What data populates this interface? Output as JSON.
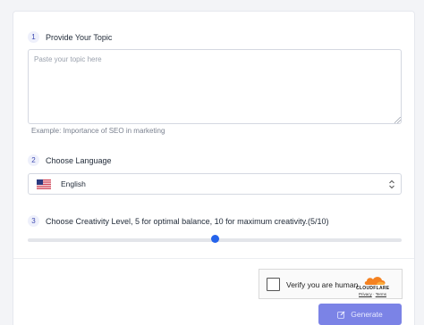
{
  "form": {
    "step1": {
      "number": "1",
      "title": "Provide Your Topic",
      "placeholder": "Paste your topic here",
      "value": "",
      "example": "Example:  Importance of SEO in marketing"
    },
    "step2": {
      "number": "2",
      "title": "Choose Language",
      "selected": "English",
      "flag_icon": "us-flag-icon"
    },
    "step3": {
      "number": "3",
      "title": "Choose Creativity Level, 5 for optimal balance, 10 for maximum creativity.(5/10)",
      "value": 5,
      "min": 0,
      "max": 10,
      "accent": "#2563eb"
    }
  },
  "captcha": {
    "label": "Verify you are human",
    "brand": "CLOUDFLARE",
    "privacy": "Privacy",
    "separator": "·",
    "terms": "Terms"
  },
  "actions": {
    "generate_label": "Generate",
    "generate_color": "#7b83e6",
    "icon": "edit-icon"
  }
}
